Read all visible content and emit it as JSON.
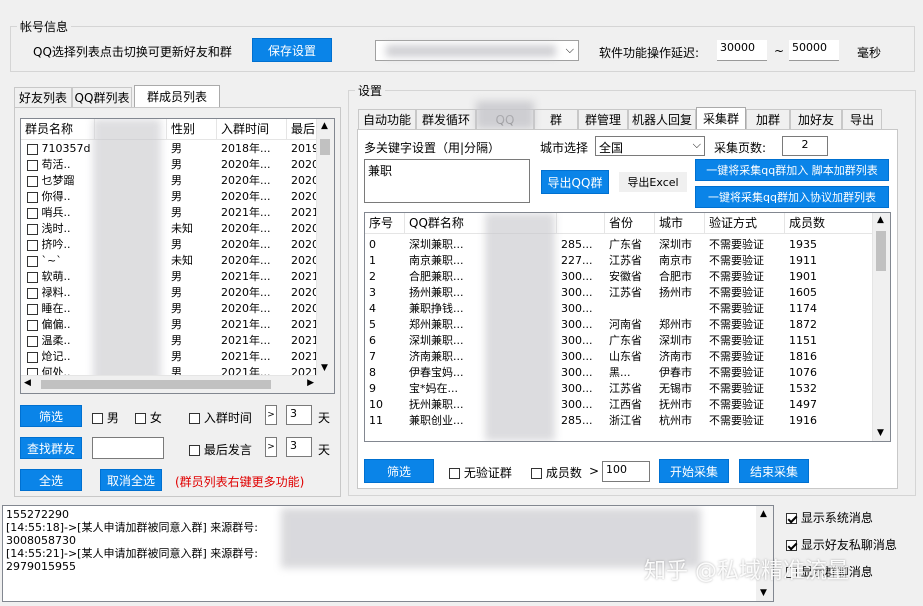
{
  "account": {
    "legend": "帐号信息",
    "hint": "QQ选择列表点击切换可更新好友和群",
    "save_btn": "保存设置",
    "delay_label": "软件功能操作延迟:",
    "delay_min": "30000",
    "delay_sep": "~",
    "delay_max": "50000",
    "delay_unit": "毫秒"
  },
  "left": {
    "tabs": [
      "好友列表",
      "QQ群列表",
      "群成员列表"
    ],
    "columns": [
      "群员名称",
      "",
      "性别",
      "入群时间",
      "最后"
    ],
    "rows": [
      {
        "name": "710357d",
        "sex": "男",
        "join": "2018年...",
        "last": "2019"
      },
      {
        "name": "苟活..",
        "sex": "男",
        "join": "2020年...",
        "last": "2020"
      },
      {
        "name": "乜梦蹓",
        "sex": "男",
        "join": "2020年...",
        "last": "2020"
      },
      {
        "name": "你得..",
        "sex": "男",
        "join": "2020年...",
        "last": "2020"
      },
      {
        "name": "哨兵..",
        "sex": "男",
        "join": "2021年...",
        "last": "2021"
      },
      {
        "name": "浅时..",
        "sex": "未知",
        "join": "2020年...",
        "last": "2020"
      },
      {
        "name": "挤吟..",
        "sex": "男",
        "join": "2020年...",
        "last": "2020"
      },
      {
        "name": "`~`",
        "sex": "未知",
        "join": "2020年...",
        "last": "2020"
      },
      {
        "name": "软萌..",
        "sex": "男",
        "join": "2021年...",
        "last": "2021"
      },
      {
        "name": "禄料..",
        "sex": "男",
        "join": "2020年...",
        "last": "2020"
      },
      {
        "name": "睡在..",
        "sex": "男",
        "join": "2020年...",
        "last": "2020"
      },
      {
        "name": "偏偏..",
        "sex": "男",
        "join": "2021年...",
        "last": "2021"
      },
      {
        "name": "温柔..",
        "sex": "男",
        "join": "2021年...",
        "last": "2021"
      },
      {
        "name": "炝记..",
        "sex": "男",
        "join": "2021年...",
        "last": "2021"
      },
      {
        "name": "何处..",
        "sex": "男",
        "join": "2021年...",
        "last": "2021"
      }
    ],
    "filter_btn": "筛选",
    "male": "男",
    "female": "女",
    "join_time": "入群时间",
    "join_op": ">",
    "join_days": "3",
    "day": "天",
    "find_btn": "查找群友",
    "last_speak": "最后发言",
    "last_op": ">",
    "last_days": "3",
    "day2": "天",
    "select_all": "全选",
    "cancel_all": "取消全选",
    "tip": "(群员列表右键更多功能)"
  },
  "settings": {
    "legend": "设置",
    "tabs": [
      "自动功能",
      "群发循环",
      "QQ",
      "群",
      "群管理",
      "机器人回复",
      "采集群",
      "加群",
      "加好友",
      "导出"
    ],
    "keyword_label": "多关键字设置（用|分隔）",
    "keyword_value": "兼职",
    "city_label": "城市选择",
    "city_value": "全国",
    "pages_label": "采集页数:",
    "pages_value": "2",
    "btn_join_script": "一键将采集qq群加入 脚本加群列表",
    "btn_join_protocol": "一键将采集qq群加入协议加群列表",
    "btn_export_qq": "导出QQ群",
    "btn_export_excel": "导出Excel",
    "columns": [
      "序号",
      "QQ群名称",
      "",
      "省份",
      "城市",
      "验证方式",
      "成员数"
    ],
    "rows": [
      {
        "no": "0",
        "name": "深圳兼职...",
        "code": "285...",
        "prov": "广东省",
        "city": "深圳市",
        "verify": "不需要验证",
        "count": "1935"
      },
      {
        "no": "1",
        "name": "南京兼职...",
        "code": "227...",
        "prov": "江苏省",
        "city": "南京市",
        "verify": "不需要验证",
        "count": "1911"
      },
      {
        "no": "2",
        "name": "合肥兼职...",
        "code": "300...",
        "prov": "安徽省",
        "city": "合肥市",
        "verify": "不需要验证",
        "count": "1901"
      },
      {
        "no": "3",
        "name": "扬州兼职...",
        "code": "300...",
        "prov": "江苏省",
        "city": "扬州市",
        "verify": "不需要验证",
        "count": "1605"
      },
      {
        "no": "4",
        "name": "兼职挣钱...",
        "code": "300...",
        "prov": "",
        "city": "",
        "verify": "不需要验证",
        "count": "1174"
      },
      {
        "no": "5",
        "name": "郑州兼职...",
        "code": "300...",
        "prov": "河南省",
        "city": "郑州市",
        "verify": "不需要验证",
        "count": "1872"
      },
      {
        "no": "6",
        "name": "深圳兼职...",
        "code": "300...",
        "prov": "广东省",
        "city": "深圳市",
        "verify": "不需要验证",
        "count": "1151"
      },
      {
        "no": "7",
        "name": "济南兼职...",
        "code": "300...",
        "prov": "山东省",
        "city": "济南市",
        "verify": "不需要验证",
        "count": "1816"
      },
      {
        "no": "8",
        "name": "伊春宝妈...",
        "code": "300...",
        "prov": "黑...",
        "city": "伊春市",
        "verify": "不需要验证",
        "count": "1076"
      },
      {
        "no": "9",
        "name": "宝*妈在...",
        "code": "300...",
        "prov": "江苏省",
        "city": "无锡市",
        "verify": "不需要验证",
        "count": "1532"
      },
      {
        "no": "10",
        "name": "抚州兼职...",
        "code": "300...",
        "prov": "江西省",
        "city": "抚州市",
        "verify": "不需要验证",
        "count": "1497"
      },
      {
        "no": "11",
        "name": "兼职创业...",
        "code": "285...",
        "prov": "浙江省",
        "city": "杭州市",
        "verify": "不需要验证",
        "count": "1916"
      }
    ],
    "filter_btn": "筛选",
    "no_verify": "无验证群",
    "member_count": "成员数",
    "member_op": ">",
    "member_value": "100",
    "start_btn": "开始采集",
    "stop_btn": "结束采集"
  },
  "log": {
    "lines": [
      "155272290",
      "[14:55:18]->[某人申请加群被同意入群] 来源群号:",
      "3008058730",
      "[14:55:21]->[某人申请加群被同意入群] 来源群号:",
      "2979015955"
    ],
    "show_system": "显示系统消息",
    "show_private": "显示好友私聊消息",
    "show_group": "显示群聊消息"
  },
  "watermark": "知乎 @私域精准流量"
}
